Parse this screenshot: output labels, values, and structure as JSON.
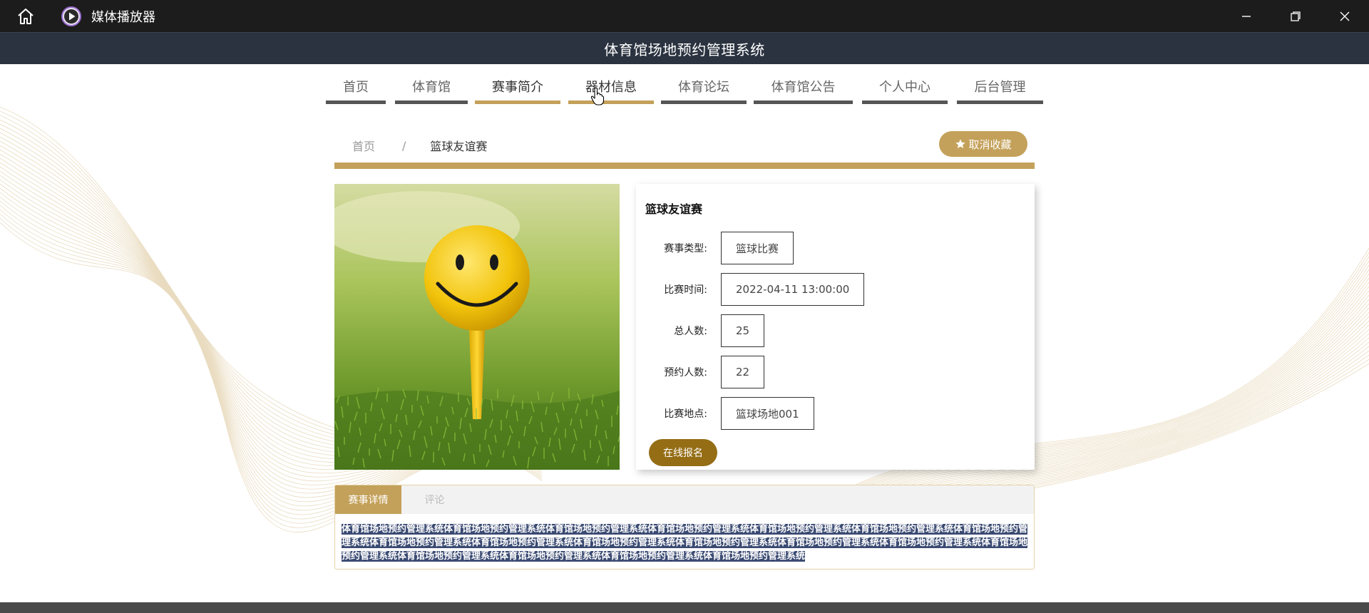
{
  "window": {
    "app_title": "媒体播放器",
    "home_icon": "home-icon",
    "app_icon": "media-player-icon",
    "controls": [
      "minimize-icon",
      "restore-icon",
      "close-icon"
    ]
  },
  "site": {
    "title": "体育馆场地预约管理系统"
  },
  "nav": {
    "items": [
      {
        "label": "首页"
      },
      {
        "label": "体育馆"
      },
      {
        "label": "赛事简介"
      },
      {
        "label": "器材信息"
      },
      {
        "label": "体育论坛"
      },
      {
        "label": "体育馆公告"
      },
      {
        "label": "个人中心"
      },
      {
        "label": "后台管理"
      }
    ],
    "active_items": [
      "赛事简介",
      "器材信息"
    ]
  },
  "breadcrumb": {
    "home": "首页",
    "separator": "/",
    "current": "篮球友谊赛"
  },
  "favorite_button": {
    "icon": "star-icon",
    "label": "取消收藏"
  },
  "event": {
    "title": "篮球友谊赛",
    "fields": [
      {
        "label": "赛事类型:",
        "value": "篮球比赛"
      },
      {
        "label": "比赛时间:",
        "value": "2022-04-11 13:00:00"
      },
      {
        "label": "总人数:",
        "value": "25"
      },
      {
        "label": "预约人数:",
        "value": "22"
      },
      {
        "label": "比赛地点:",
        "value": "篮球场地001"
      }
    ],
    "signup_label": "在线报名"
  },
  "detail": {
    "tabs": [
      {
        "label": "赛事详情"
      },
      {
        "label": "评论"
      }
    ],
    "active_tab": "赛事详情",
    "content": "体育馆场地预约管理系统体育馆场地预约管理系统体育馆场地预约管理系统体育馆场地预约管理系统体育馆场地预约管理系统体育馆场地预约管理系统体育馆场地预约管理系统体育馆场地预约管理系统体育馆场地预约管理系统体育馆场地预约管理系统体育馆场地预约管理系统体育馆场地预约管理系统体育馆场地预约管理系统体育馆场地预约管理系统体育馆场地预约管理系统体育馆场地预约管理系统体育馆场地预约管理系统体育馆场地预约管理系统"
  },
  "colors": {
    "gold": "#c4a15a",
    "dark_gold": "#946d15",
    "header_bg": "#2b3340",
    "titlebar_bg": "#1c1c1c"
  }
}
